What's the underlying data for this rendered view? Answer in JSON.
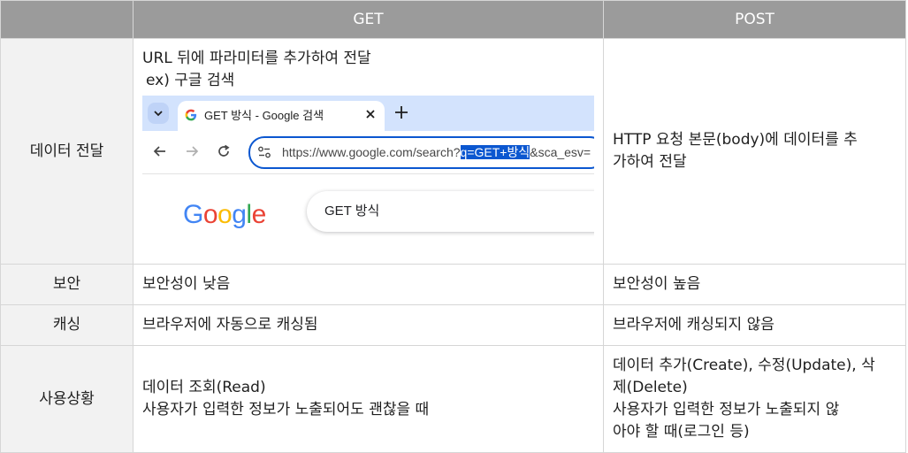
{
  "table": {
    "headers": [
      "",
      "GET",
      "POST"
    ],
    "rows": [
      {
        "label": "데이터 전달",
        "get_lines": [
          "URL 뒤에 파라미터를 추가하여 전달",
          "ex) 구글 검색"
        ],
        "post_lines": [
          "HTTP 요청 본문(body)에 데이터를 추",
          "가하여 전달"
        ]
      },
      {
        "label": "보안",
        "get_lines": [
          "보안성이 낮음"
        ],
        "post_lines": [
          "보안성이 높음"
        ]
      },
      {
        "label": "캐싱",
        "get_lines": [
          "브라우저에 자동으로 캐싱됨"
        ],
        "post_lines": [
          "브라우저에 캐싱되지 않음"
        ]
      },
      {
        "label": "사용상황",
        "get_lines": [
          "데이터 조회(Read)",
          "사용자가 입력한 정보가 노출되어도 괜찮을 때"
        ],
        "post_lines": [
          "데이터 추가(Create), 수정(Update), 삭",
          "제(Delete)",
          "사용자가 입력한 정보가 노출되지 않",
          "아야 할 때(로그인 등)"
        ]
      }
    ]
  },
  "browser": {
    "tab_title": "GET 방식 - Google 검색",
    "url_before": "https://www.google.com/search?",
    "url_highlight": "q=GET+방식",
    "url_after": "&sca_esv=",
    "search_query": "GET 방식",
    "logo_letters": [
      "G",
      "o",
      "o",
      "g",
      "l",
      "e"
    ],
    "logo_colors": [
      "#4285F4",
      "#EA4335",
      "#FBBC05",
      "#4285F4",
      "#34A853",
      "#EA4335"
    ],
    "highlight_color": "#0b57d0",
    "tabbar_color": "#d3e3fd"
  }
}
